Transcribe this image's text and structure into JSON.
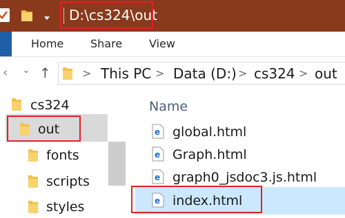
{
  "window": {
    "title": "D:\\cs324\\out",
    "title_bar_color": "#8a3a1c",
    "highlight_color": "#e0202a"
  },
  "ribbon": {
    "tabs": [
      {
        "label": "Home"
      },
      {
        "label": "Share"
      },
      {
        "label": "View"
      }
    ]
  },
  "address": {
    "breadcrumbs": [
      "This PC",
      "Data (D:)",
      "cs324",
      "out"
    ],
    "separator": ">",
    "back_icon": "chevron-down-icon",
    "up_icon": "up-arrow-icon"
  },
  "nav": {
    "items": [
      {
        "label": "cs324",
        "selected": false
      },
      {
        "label": "out",
        "selected": true
      },
      {
        "label": "fonts",
        "selected": false
      },
      {
        "label": "scripts",
        "selected": false
      },
      {
        "label": "styles",
        "selected": false
      }
    ]
  },
  "content": {
    "column_header": "Name",
    "files": [
      {
        "name": "global.html",
        "icon": "edge-html-file-icon",
        "selected": false
      },
      {
        "name": "Graph.html",
        "icon": "edge-html-file-icon",
        "selected": false
      },
      {
        "name": "graph0_jsdoc3.js.html",
        "icon": "edge-html-file-icon",
        "selected": false
      },
      {
        "name": "index.html",
        "icon": "edge-html-file-icon",
        "selected": true
      }
    ],
    "selection_color": "#cce8ff"
  }
}
